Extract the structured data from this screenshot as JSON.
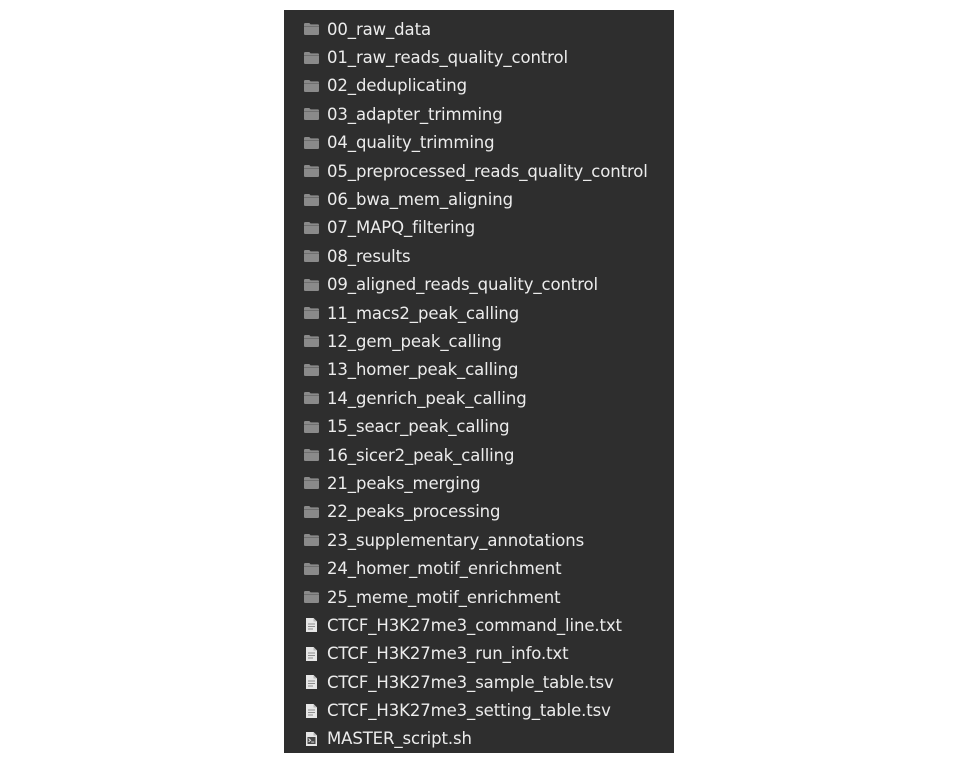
{
  "colors": {
    "panel_background": "#2e2e2e",
    "text": "#ececec",
    "folder_icon": "#8a8a8a",
    "file_icon": "#e6e6e6"
  },
  "items": [
    {
      "name": "00_raw_data",
      "icon": "folder-icon"
    },
    {
      "name": "01_raw_reads_quality_control",
      "icon": "folder-icon"
    },
    {
      "name": "02_deduplicating",
      "icon": "folder-icon"
    },
    {
      "name": "03_adapter_trimming",
      "icon": "folder-icon"
    },
    {
      "name": "04_quality_trimming",
      "icon": "folder-icon"
    },
    {
      "name": "05_preprocessed_reads_quality_control",
      "icon": "folder-icon"
    },
    {
      "name": "06_bwa_mem_aligning",
      "icon": "folder-icon"
    },
    {
      "name": "07_MAPQ_filtering",
      "icon": "folder-icon"
    },
    {
      "name": "08_results",
      "icon": "folder-icon"
    },
    {
      "name": "09_aligned_reads_quality_control",
      "icon": "folder-icon"
    },
    {
      "name": "11_macs2_peak_calling",
      "icon": "folder-icon"
    },
    {
      "name": "12_gem_peak_calling",
      "icon": "folder-icon"
    },
    {
      "name": "13_homer_peak_calling",
      "icon": "folder-icon"
    },
    {
      "name": "14_genrich_peak_calling",
      "icon": "folder-icon"
    },
    {
      "name": "15_seacr_peak_calling",
      "icon": "folder-icon"
    },
    {
      "name": "16_sicer2_peak_calling",
      "icon": "folder-icon"
    },
    {
      "name": "21_peaks_merging",
      "icon": "folder-icon"
    },
    {
      "name": "22_peaks_processing",
      "icon": "folder-icon"
    },
    {
      "name": "23_supplementary_annotations",
      "icon": "folder-icon"
    },
    {
      "name": "24_homer_motif_enrichment",
      "icon": "folder-icon"
    },
    {
      "name": "25_meme_motif_enrichment",
      "icon": "folder-icon"
    },
    {
      "name": "CTCF_H3K27me3_command_line.txt",
      "icon": "text-file-icon"
    },
    {
      "name": "CTCF_H3K27me3_run_info.txt",
      "icon": "text-file-icon"
    },
    {
      "name": "CTCF_H3K27me3_sample_table.tsv",
      "icon": "text-file-icon"
    },
    {
      "name": "CTCF_H3K27me3_setting_table.tsv",
      "icon": "text-file-icon"
    },
    {
      "name": "MASTER_script.sh",
      "icon": "script-file-icon"
    }
  ]
}
